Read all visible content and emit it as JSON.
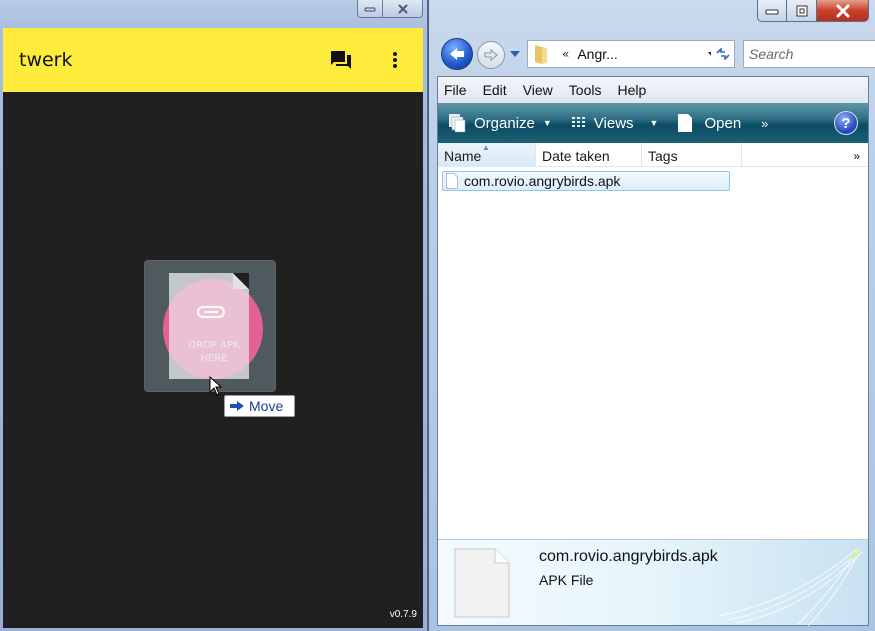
{
  "twerk": {
    "title": "twerk",
    "dropzone_text_line1": "DROP APK",
    "dropzone_text_line2": "HERE",
    "version": "v0.7.9",
    "drag_tooltip": "Move",
    "colors": {
      "appbar": "#ffeb3b",
      "background": "#202020",
      "accent": "#e9649b"
    }
  },
  "explorer": {
    "address_chevron": "«",
    "address_crumb": "Angr...",
    "search_placeholder": "Search",
    "menu": [
      "File",
      "Edit",
      "View",
      "Tools",
      "Help"
    ],
    "toolbar": {
      "organize": "Organize",
      "views": "Views",
      "open": "Open",
      "more": "»"
    },
    "columns": [
      "Name",
      "Date taken",
      "Tags"
    ],
    "columns_more": "»",
    "files": [
      {
        "name": "com.rovio.angrybirds.apk"
      }
    ],
    "details": {
      "name": "com.rovio.angrybirds.apk",
      "type": "APK File"
    }
  }
}
